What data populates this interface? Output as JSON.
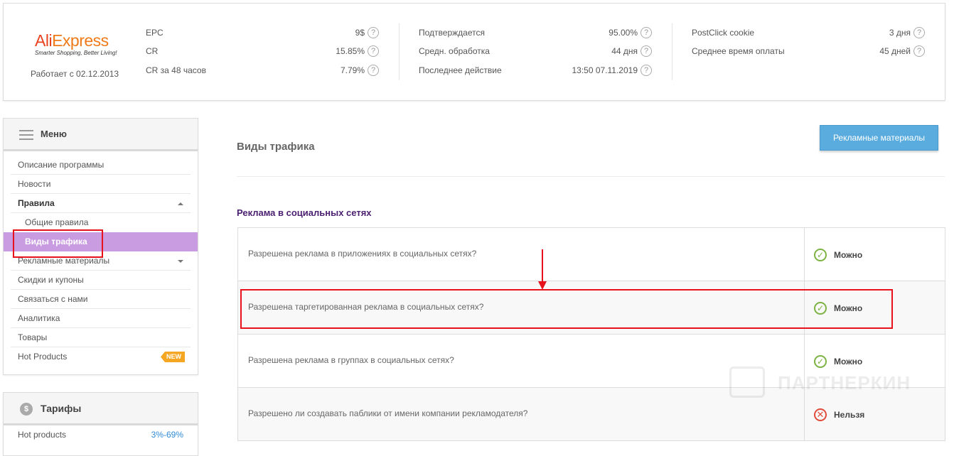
{
  "header": {
    "logo": {
      "ali": "Ali",
      "express": "Express",
      "tagline": "Smarter Shopping, Better Living!"
    },
    "since": "Работает с 02.12.2013",
    "stats_col1": [
      {
        "label": "EPC",
        "value": "9$"
      },
      {
        "label": "CR",
        "value": "15.85%"
      },
      {
        "label": "CR за 48 часов",
        "value": "7.79%"
      }
    ],
    "stats_col2": [
      {
        "label": "Подтверждается",
        "value": "95.00%"
      },
      {
        "label": "Средн. обработка",
        "value": "44 дня"
      },
      {
        "label": "Последнее действие",
        "value": "13:50 07.11.2019"
      }
    ],
    "stats_col3": [
      {
        "label": "PostClick cookie",
        "value": "3 дня"
      },
      {
        "label": "Среднее время оплаты",
        "value": "45 дней"
      }
    ],
    "help_glyph": "?"
  },
  "sidebar": {
    "menu_title": "Меню",
    "items": [
      {
        "label": "Описание программы"
      },
      {
        "label": "Новости"
      },
      {
        "label": "Правила"
      },
      {
        "label": "Общие правила"
      },
      {
        "label": "Виды трафика"
      },
      {
        "label": "Рекламные материалы"
      },
      {
        "label": "Скидки и купоны"
      },
      {
        "label": "Связаться с нами"
      },
      {
        "label": "Аналитика"
      },
      {
        "label": "Товары"
      },
      {
        "label": "Hot Products",
        "badge": "NEW"
      }
    ],
    "tariffs_title": "Тарифы",
    "tariffs_icon": "$",
    "tariffs": [
      {
        "label": "Hot products",
        "value": "3%-69%"
      }
    ]
  },
  "main": {
    "title": "Виды трафика",
    "ads_button": "Рекламные материалы",
    "section_title": "Реклама в социальных сетях",
    "rules": [
      {
        "question": "Разрешена реклама в приложениях в социальных сетях?",
        "status": "Можно",
        "allowed": true
      },
      {
        "question": "Разрешена таргетированная реклама в социальных сетях?",
        "status": "Можно",
        "allowed": true
      },
      {
        "question": "Разрешена реклама в группах в социальных сетях?",
        "status": "Можно",
        "allowed": true
      },
      {
        "question": "Разрешено ли создавать паблики от имени компании рекламодателя?",
        "status": "Нельзя",
        "allowed": false
      }
    ],
    "ok_glyph": "✓",
    "no_glyph": "✕"
  },
  "watermark": "ПАРТНЕРКИН",
  "colors": {
    "accent_purple": "#c99be0",
    "button_blue": "#5aacde",
    "annotation_red": "#e8121c",
    "ok_green": "#7cb342",
    "no_red": "#e04b3b"
  }
}
